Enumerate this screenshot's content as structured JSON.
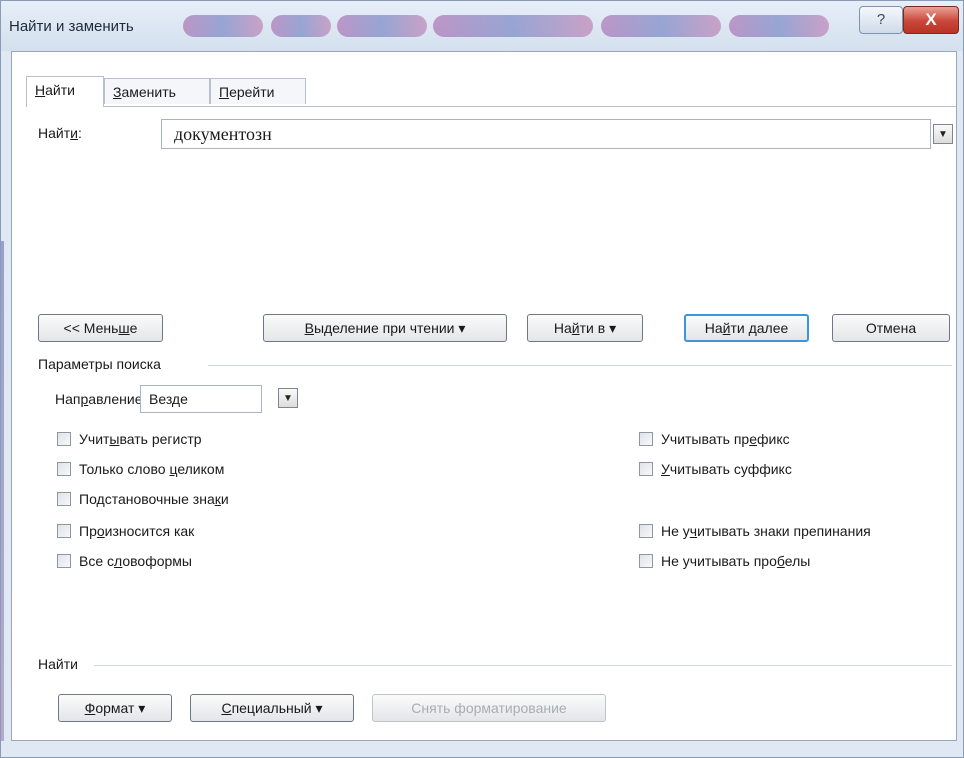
{
  "window": {
    "title": "Найти и заменить",
    "help_label": "?",
    "close_label": "X"
  },
  "tabs": [
    {
      "pre": "",
      "key": "Н",
      "post": "айти"
    },
    {
      "pre": "",
      "key": "З",
      "post": "аменить"
    },
    {
      "pre": "",
      "key": "П",
      "post": "ерейти"
    }
  ],
  "find": {
    "label_pre": "Найт",
    "label_key": "и",
    "label_post": ":",
    "value": "документозн"
  },
  "buttons": {
    "less": {
      "pre": "<< Мень",
      "key": "ш",
      "post": "е"
    },
    "reading_highlight": {
      "pre": "",
      "key": "В",
      "post": "ыделение при чтении"
    },
    "find_in": {
      "pre": "На",
      "key": "й",
      "post": "ти в"
    },
    "find_next": {
      "pre": "На",
      "key": "й",
      "post": "ти далее"
    },
    "cancel": "Отмена"
  },
  "search_options": {
    "group_label": "Параметры поиска",
    "direction_label_pre": "Нап",
    "direction_label_key": "р",
    "direction_label_post": "авление:",
    "direction_value": "Везде",
    "left": [
      {
        "pre": "Учит",
        "key": "ы",
        "post": "вать регистр"
      },
      {
        "pre": "Только слово ",
        "key": "ц",
        "post": "еликом"
      },
      {
        "pre": "Подстановочные зна",
        "key": "к",
        "post": "и"
      },
      {
        "pre": "Пр",
        "key": "о",
        "post": "износится как"
      },
      {
        "pre": "Все с",
        "key": "л",
        "post": "овоформы"
      }
    ],
    "right": [
      {
        "pre": "Учитывать пр",
        "key": "е",
        "post": "фикс"
      },
      {
        "pre": "",
        "key": "У",
        "post": "читывать суффикс"
      },
      {
        "pre": "Не у",
        "key": "ч",
        "post": "итывать знаки препинания"
      },
      {
        "pre": "Не учитывать про",
        "key": "б",
        "post": "елы"
      }
    ]
  },
  "find_format": {
    "group_label": "Найти",
    "format": {
      "pre": "",
      "key": "Ф",
      "post": "ормат"
    },
    "special": {
      "pre": "",
      "key": "С",
      "post": "пециальный"
    },
    "clear_format": "Снять форматирование"
  },
  "glyphs": {
    "dropdown_arrow": "▼",
    "menu_arrow": "▾"
  }
}
